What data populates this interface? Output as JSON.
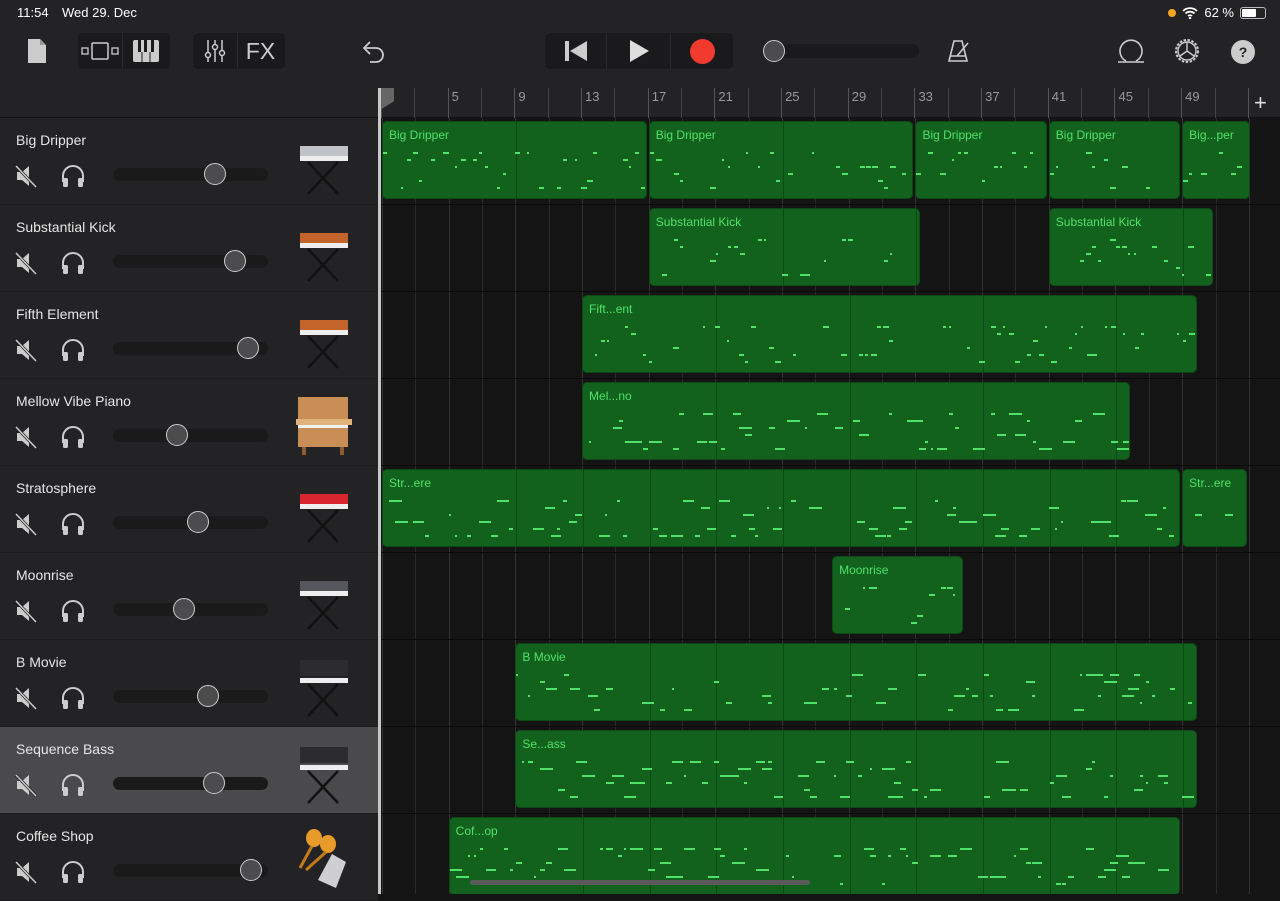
{
  "status_bar": {
    "time": "11:54",
    "date": "Wed 29. Dec",
    "battery": "62 %",
    "battery_level": 0.62,
    "icons": [
      "orange-dot",
      "wifi-icon",
      "battery-icon"
    ]
  },
  "toolbar": {
    "icons": [
      "document-icon",
      "tracks-view-icon",
      "keyboard-icon",
      "mixer-icon",
      "undo-icon",
      "go-to-start-icon",
      "play-icon",
      "record-icon",
      "metronome-icon",
      "loop-icon",
      "settings-icon",
      "help-icon"
    ],
    "fx_label": "FX",
    "record_color": "#f23a2f",
    "master_volume": 0.0
  },
  "ruler": {
    "labels": [
      "1",
      "5",
      "9",
      "13",
      "17",
      "21",
      "25",
      "29",
      "33",
      "37",
      "41",
      "45",
      "49"
    ],
    "playhead_bar": 1,
    "add_label": "+"
  },
  "colors": {
    "region_fill": "#12621e",
    "region_text": "#4fe26a",
    "selected_track": "#4a4a4c"
  },
  "tracks": [
    {
      "name": "Big Dripper",
      "volume": 0.66,
      "instrument": "synth-keyboard",
      "color": "#bfc3c8",
      "regions": [
        {
          "label": "Big Dripper",
          "start": 1,
          "end": 17
        },
        {
          "label": "Big Dripper",
          "start": 17,
          "end": 33
        },
        {
          "label": "Big Dripper",
          "start": 33,
          "end": 41
        },
        {
          "label": "Big Dripper",
          "start": 41,
          "end": 49
        },
        {
          "label": "Big...per",
          "start": 49,
          "end": 53.2
        }
      ]
    },
    {
      "name": "Substantial Kick",
      "volume": 0.79,
      "instrument": "analog-synth",
      "color": "#c4642a",
      "regions": [
        {
          "label": "Substantial Kick",
          "start": 17,
          "end": 33.4
        },
        {
          "label": "Substantial Kick",
          "start": 41,
          "end": 51
        }
      ]
    },
    {
      "name": "Fifth Element",
      "volume": 0.87,
      "instrument": "analog-synth",
      "color": "#c4642a",
      "regions": [
        {
          "label": "Fift...ent",
          "start": 13,
          "end": 50
        }
      ]
    },
    {
      "name": "Mellow Vibe Piano",
      "volume": 0.41,
      "instrument": "upright-piano",
      "color": "#c88e55",
      "regions": [
        {
          "label": "Mel...no",
          "start": 13,
          "end": 46
        }
      ]
    },
    {
      "name": "Stratosphere",
      "volume": 0.55,
      "instrument": "stage-keyboard",
      "color": "#d8262e",
      "regions": [
        {
          "label": "Str...ere",
          "start": 1,
          "end": 49
        },
        {
          "label": "Str...ere",
          "start": 49,
          "end": 53
        }
      ]
    },
    {
      "name": "Moonrise",
      "volume": 0.46,
      "instrument": "synth-keyboard",
      "color": "#55555c",
      "regions": [
        {
          "label": "Moonrise",
          "start": 28,
          "end": 36
        }
      ]
    },
    {
      "name": "B Movie",
      "volume": 0.61,
      "instrument": "modular-synth",
      "color": "#2c2c2e",
      "regions": [
        {
          "label": "B Movie",
          "start": 9,
          "end": 50
        }
      ]
    },
    {
      "name": "Sequence Bass",
      "volume": 0.65,
      "instrument": "modular-synth",
      "color": "#2c2c2e",
      "selected": true,
      "regions": [
        {
          "label": "Se...ass",
          "start": 9,
          "end": 50
        }
      ]
    },
    {
      "name": "Coffee Shop",
      "volume": 0.89,
      "instrument": "percussion",
      "color": "#e8a23a",
      "regions": [
        {
          "label": "Cof...op",
          "start": 5,
          "end": 49
        }
      ]
    }
  ]
}
